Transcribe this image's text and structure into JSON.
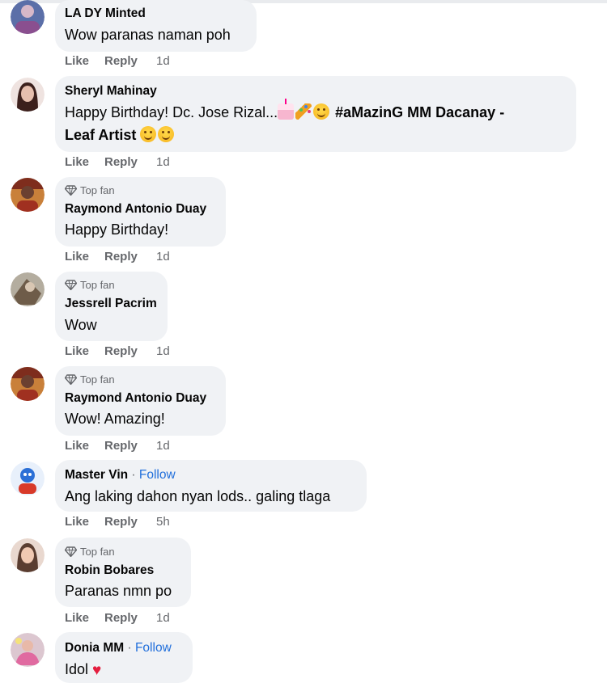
{
  "actions": {
    "like": "Like",
    "reply": "Reply"
  },
  "comments": [
    {
      "name": "LA DY Minted",
      "text": "Wow paranas naman poh",
      "time": "1d",
      "avatar_color": "#5b6fa8"
    },
    {
      "name": "Sheryl Mahinay",
      "text_line1": "Happy Birthday! Dc. Jose Rizal...",
      "mention_1": "#aMazinG MM Dacanay -",
      "mention_2": "Leaf Artist",
      "time": "1d",
      "avatar_color": "#5a3a36"
    },
    {
      "badge": "Top fan",
      "name": "Raymond Antonio Duay",
      "text": "Happy Birthday!",
      "time": "1d",
      "avatar_color": "#a8462e"
    },
    {
      "badge": "Top fan",
      "name": "Jessrell Pacrim",
      "text": "Wow",
      "time": "1d",
      "avatar_color": "#8a7c6a"
    },
    {
      "badge": "Top fan",
      "name": "Raymond Antonio Duay",
      "text": "Wow! Amazing!",
      "time": "1d",
      "avatar_color": "#a8462e"
    },
    {
      "name": "Master Vin",
      "follow": "Follow",
      "text": "Ang laking dahon nyan lods.. galing tlaga",
      "time": "5h",
      "avatar_color": "#2b6fd6"
    },
    {
      "badge": "Top fan",
      "name": "Robin Bobares",
      "text": "Paranas nmn po",
      "time": "1d",
      "avatar_color": "#b89a86"
    },
    {
      "name": "Donia MM",
      "follow": "Follow",
      "text": "Idol",
      "avatar_color": "#c9a7b5"
    }
  ]
}
